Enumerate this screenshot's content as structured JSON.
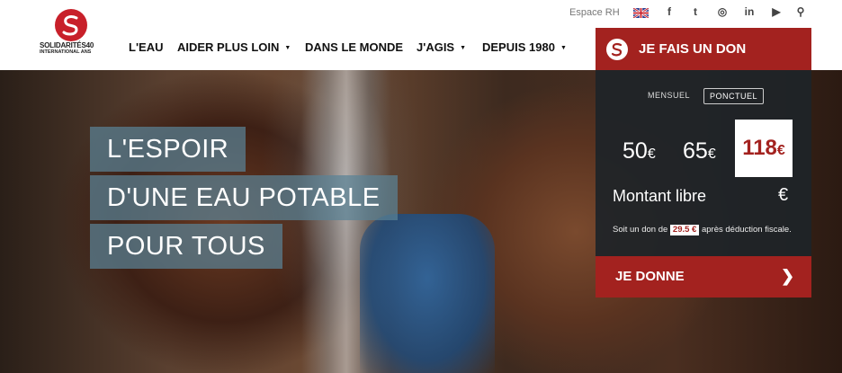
{
  "utility": {
    "espace": "Espace RH",
    "social_icons": [
      "facebook-icon",
      "twitter-icon",
      "instagram-icon",
      "linkedin-icon",
      "youtube-icon",
      "search-icon"
    ],
    "social_glyphs": [
      "f",
      "t",
      "◎",
      "in",
      "▶",
      "⚲"
    ]
  },
  "logo": {
    "line1": "SOLIDARITÉS40",
    "line2": "INTERNATIONAL ANS"
  },
  "nav": {
    "items": [
      {
        "label": "L'EAU"
      },
      {
        "label": "AIDER PLUS LOIN"
      },
      {
        "label": "DANS LE MONDE"
      },
      {
        "label": "J'AGIS"
      },
      {
        "label": "DEPUIS 1980"
      }
    ]
  },
  "hero": {
    "lines": [
      "L'ESPOIR",
      "D'UNE EAU POTABLE",
      "POUR TOUS"
    ]
  },
  "donation": {
    "title": "JE FAIS UN DON",
    "frequency": [
      "MENSUEL",
      "PONCTUEL"
    ],
    "selected_frequency": "PONCTUEL",
    "amounts": [
      {
        "value": "50",
        "unit": "€"
      },
      {
        "value": "65",
        "unit": "€"
      },
      {
        "value": "118",
        "unit": "€"
      }
    ],
    "selected_amount": "118",
    "libre_label": "Montant libre",
    "libre_currency": "€",
    "fiscal_prefix": "Soit un don de",
    "fiscal_value": "29.5 €",
    "fiscal_suffix": "après déduction fiscale.",
    "cta": "JE DONNE",
    "cta_arrow": "❯"
  },
  "colors": {
    "brand_red": "#a3221f",
    "headline_bg": "#5a8296",
    "panel_bg": "#1e2428"
  }
}
